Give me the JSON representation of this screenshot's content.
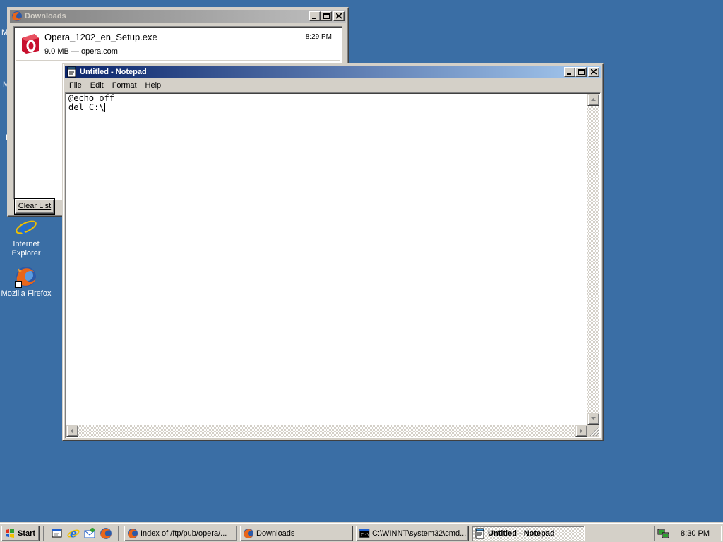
{
  "desktop": {
    "icons": [
      {
        "label_line1": "Internet",
        "label_line2": "Explorer",
        "icon": "internet-explorer-icon"
      },
      {
        "label_line1": "Mozilla Firefox",
        "label_line2": "",
        "icon": "firefox-icon"
      }
    ],
    "partial_labels": [
      "M",
      "M",
      "I"
    ]
  },
  "downloads_window": {
    "title": "Downloads",
    "item": {
      "filename": "Opera_1202_en_Setup.exe",
      "meta": "9.0 MB — opera.com",
      "time": "8:29 PM",
      "icon": "opera-installer-icon"
    },
    "clear_button": "Clear List"
  },
  "notepad": {
    "title": "Untitled - Notepad",
    "menu": [
      "File",
      "Edit",
      "Format",
      "Help"
    ],
    "content_line1": "@echo off",
    "content_line2": "del C:\\"
  },
  "taskbar": {
    "start_label": "Start",
    "quick_launch": [
      "show-desktop-icon",
      "internet-explorer-icon",
      "outlook-icon",
      "firefox-icon"
    ],
    "tasks": [
      {
        "label": "Index of /ftp/pub/opera/...",
        "icon": "firefox-icon",
        "active": false
      },
      {
        "label": "Downloads",
        "icon": "firefox-icon",
        "active": false
      },
      {
        "label": "C:\\WINNT\\system32\\cmd...",
        "icon": "cmd-icon",
        "active": false
      },
      {
        "label": "Untitled - Notepad",
        "icon": "notepad-icon",
        "active": true
      }
    ],
    "clock": "8:30 PM"
  },
  "colors": {
    "desktop": "#3a6ea5",
    "active_title": "#0a246a",
    "inactive_title": "#808080",
    "face": "#d4d0c8"
  }
}
